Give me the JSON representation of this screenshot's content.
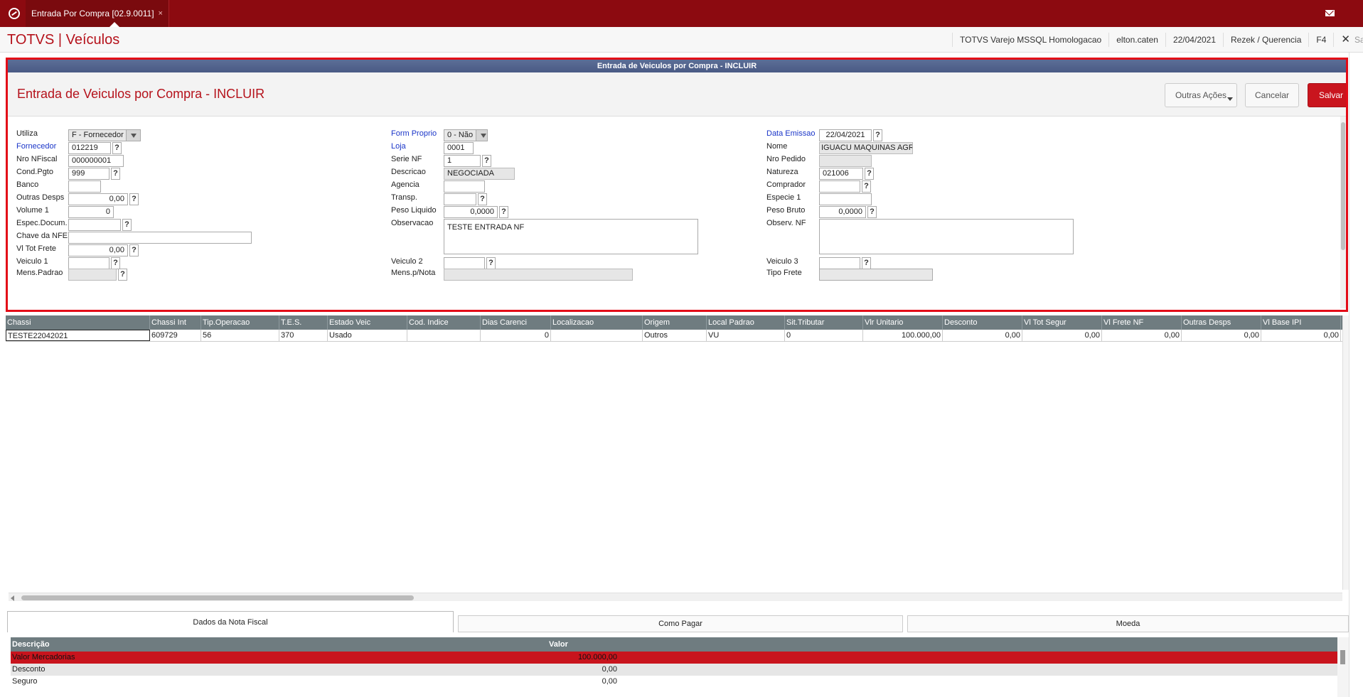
{
  "topbar": {
    "tab_label": "Entrada Por Compra [02.9.0011]",
    "tab_close": "×"
  },
  "header": {
    "app_title": "TOTVS | Veículos",
    "environment": "TOTVS Varejo MSSQL Homologacao",
    "user": "elton.caten",
    "date": "22/04/2021",
    "company": "Rezek / Querencia",
    "shortcut": "F4",
    "exit_label": "Sair",
    "close_glyph": "✕"
  },
  "dialog": {
    "bar_title": "Entrada de Veiculos por Compra - INCLUIR",
    "heading": "Entrada de Veiculos por Compra - INCLUIR",
    "buttons": {
      "outras": "Outras Ações",
      "cancel": "Cancelar",
      "save": "Salvar"
    }
  },
  "form": {
    "utiliza_label": "Utiliza",
    "utiliza_value": "F - Fornecedor",
    "fornecedor_label": "Fornecedor",
    "fornecedor_value": "012219",
    "nro_nfiscal_label": "Nro NFiscal",
    "nro_nfiscal_value": "000000001",
    "cond_pgto_label": "Cond.Pgto",
    "cond_pgto_value": "999",
    "banco_label": "Banco",
    "banco_value": "",
    "outras_desps_label": "Outras Desps",
    "outras_desps_value": "0,00",
    "volume_label": "Volume 1",
    "volume_value": "0",
    "espec_docum_label": "Espec.Docum.",
    "espec_docum_value": "",
    "chave_nfe_label": "Chave da NFE",
    "chave_nfe_value": "",
    "vl_tot_frete_label": "Vl Tot Frete",
    "vl_tot_frete_value": "0,00",
    "veiculo1_label": "Veiculo 1",
    "veiculo1_value": "",
    "mens_padrao_label": "Mens.Padrao",
    "form_proprio_label": "Form Proprio",
    "form_proprio_value": "0 - Não",
    "loja_label": "Loja",
    "loja_value": "0001",
    "serie_nf_label": "Serie NF",
    "serie_nf_value": "1",
    "descricao_label": "Descricao",
    "descricao_value": "NEGOCIADA",
    "agencia_label": "Agencia",
    "agencia_value": "",
    "transp_label": "Transp.",
    "transp_value": "",
    "peso_liquido_label": "Peso Liquido",
    "peso_liquido_value": "0,0000",
    "observacao_label": "Observacao",
    "observacao_value": "TESTE ENTRADA NF",
    "veiculo2_label": "Veiculo 2",
    "veiculo2_value": "",
    "mens_nota_label": "Mens.p/Nota",
    "data_emissao_label": "Data Emissao",
    "data_emissao_value": "22/04/2021",
    "nome_label": "Nome",
    "nome_value": "IGUACU MAQUINAS AGRICOLA",
    "nro_pedido_label": "Nro Pedido",
    "nro_pedido_value": "",
    "natureza_label": "Natureza",
    "natureza_value": "021006",
    "comprador_label": "Comprador",
    "comprador_value": "",
    "especie1_label": "Especie 1",
    "especie1_value": "",
    "peso_bruto_label": "Peso Bruto",
    "peso_bruto_value": "0,0000",
    "observ_nf_label": "Observ. NF",
    "observ_nf_value": "",
    "veiculo3_label": "Veiculo 3",
    "veiculo3_value": "",
    "tipo_frete_label": "Tipo Frete",
    "help": "?"
  },
  "grid": {
    "columns": [
      "Chassi",
      "Chassi Int",
      "Tip.Operacao",
      "T.E.S.",
      "Estado Veic",
      "Cod. Indice",
      "Dias Carenci",
      "Localizacao",
      "Origem",
      "Local Padrao",
      "Sit.Tributar",
      "Vlr Unitario",
      "Desconto",
      "Vl Tot Segur",
      "Vl Frete NF",
      "Outras Desps",
      "Vl Base IPI"
    ],
    "rows": [
      [
        "TESTE22042021",
        "609729",
        "56",
        "370",
        "Usado",
        "",
        "0",
        "",
        "Outros",
        "VU",
        "0",
        "100.000,00",
        "0,00",
        "0,00",
        "0,00",
        "0,00",
        "0,00"
      ]
    ]
  },
  "tabs": [
    "Dados da Nota Fiscal",
    "Como Pagar",
    "Moeda"
  ],
  "summary": {
    "columns": [
      "Descrição",
      "Valor"
    ],
    "rows": [
      [
        "Valor Mercadorias",
        "100.000,00"
      ],
      [
        "Desconto",
        "0,00"
      ],
      [
        "Seguro",
        "0,00"
      ]
    ]
  }
}
